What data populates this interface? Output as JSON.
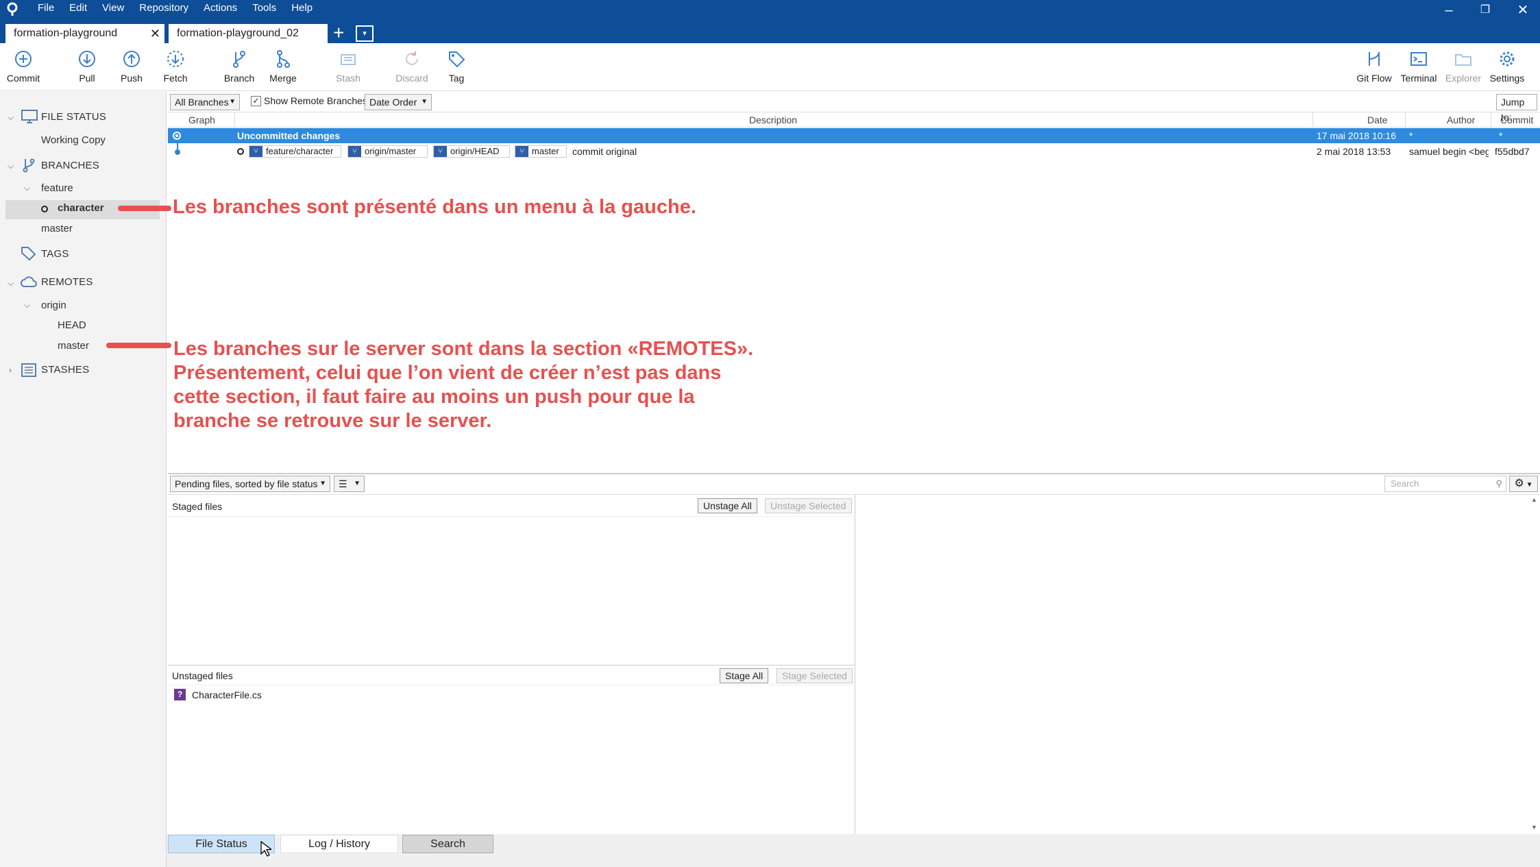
{
  "menu": [
    "File",
    "Edit",
    "View",
    "Repository",
    "Actions",
    "Tools",
    "Help"
  ],
  "window_controls": {
    "minimize": "–",
    "restore": "❐",
    "close": "✕"
  },
  "tabs": [
    {
      "label": "formation-playground"
    },
    {
      "label": "formation-playground_02"
    }
  ],
  "tab_close": "✕",
  "tab_add": "+",
  "tab_menu": "▾",
  "toolbar": {
    "commit": "Commit",
    "pull": "Pull",
    "push": "Push",
    "fetch": "Fetch",
    "branch": "Branch",
    "merge": "Merge",
    "stash": "Stash",
    "discard": "Discard",
    "tag": "Tag",
    "gitflow": "Git Flow",
    "terminal": "Terminal",
    "explorer": "Explorer",
    "settings": "Settings"
  },
  "sidebar": {
    "file_status": "FILE STATUS",
    "working_copy": "Working Copy",
    "branches": "BRANCHES",
    "feature": "feature",
    "character": "character",
    "master": "master",
    "tags": "TAGS",
    "remotes": "REMOTES",
    "origin": "origin",
    "head": "HEAD",
    "origin_master": "master",
    "stashes": "STASHES"
  },
  "filter": {
    "branches": "All Branches",
    "show_remote": "Show Remote Branches",
    "order": "Date Order",
    "jump": "Jump to:"
  },
  "columns": {
    "graph": "Graph",
    "description": "Description",
    "date": "Date",
    "author": "Author",
    "commit": "Commit"
  },
  "commits": [
    {
      "description": "Uncommitted changes",
      "date": "17 mai 2018 10:16",
      "author": "*",
      "commit": "*"
    },
    {
      "badges": [
        "feature/character",
        "origin/master",
        "origin/HEAD",
        "master"
      ],
      "description": "commit original",
      "date": "2 mai 2018 13:53",
      "author": "samuel begin <beg",
      "commit": "f55dbd7"
    }
  ],
  "annotations": {
    "branches_left": "Les branches sont présenté dans un menu à la gauche.",
    "remotes": "Les branches sur le server sont dans la section «REMOTES».\nPrésentement, celui que l’on vient de créer n’est pas dans\ncette section, il faut faire au moins un push pour que la\nbranche se retrouve sur le server.",
    "color": "#e85050"
  },
  "pending": {
    "sort": "Pending files, sorted by file status",
    "search_placeholder": "Search"
  },
  "staged": {
    "title": "Staged files",
    "unstage_all": "Unstage All",
    "unstage_selected": "Unstage Selected"
  },
  "unstaged": {
    "title": "Unstaged files",
    "stage_all": "Stage All",
    "stage_selected": "Stage Selected",
    "files": [
      {
        "name": "CharacterFile.cs",
        "status_icon": "?"
      }
    ]
  },
  "bottom_tabs": {
    "file_status": "File Status",
    "log_history": "Log / History",
    "search": "Search"
  },
  "colors": {
    "titlebar": "#0e4d97",
    "selection": "#2e8ade",
    "branch_badge": "#2d5fa8"
  }
}
